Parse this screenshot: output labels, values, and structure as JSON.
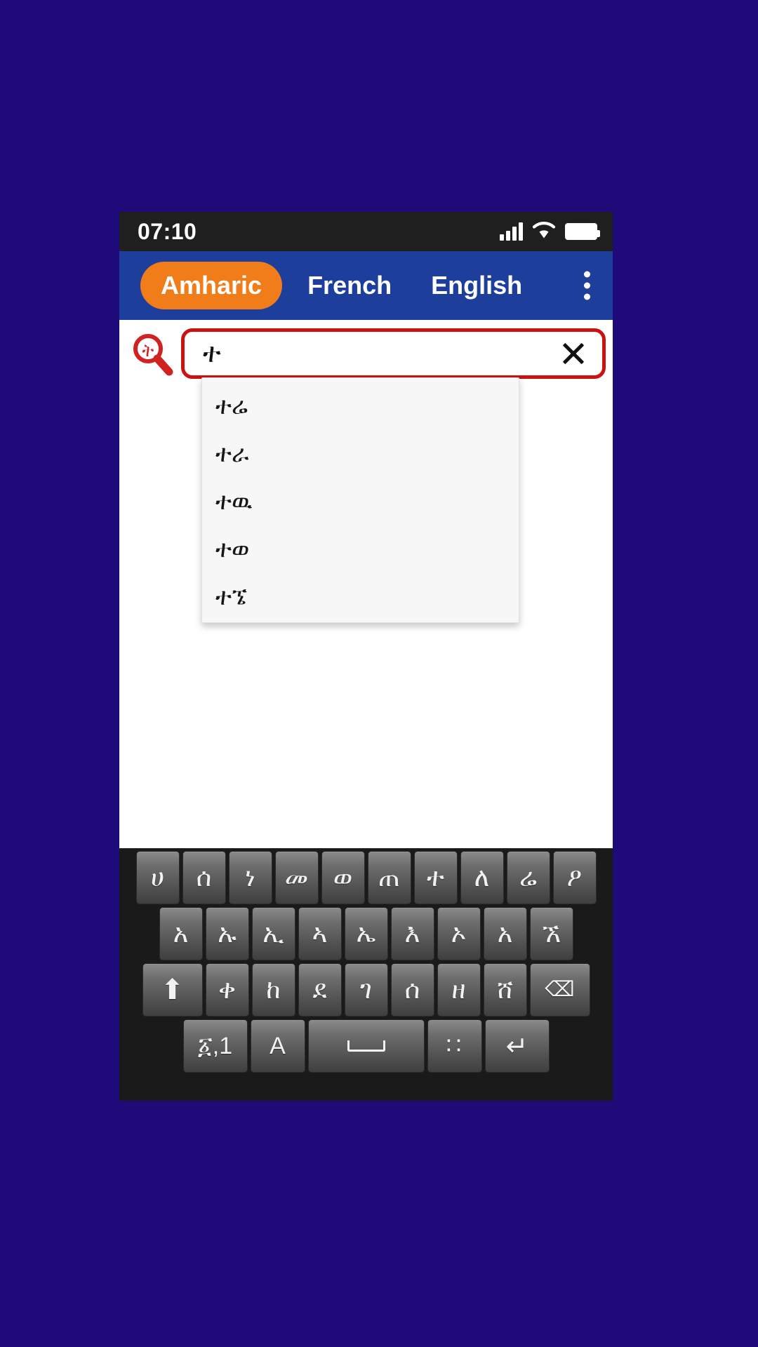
{
  "statusbar": {
    "time": "07:10",
    "icons": [
      "signal-bars-icon",
      "wifi-icon",
      "battery-icon"
    ]
  },
  "tabbar": {
    "tabs": [
      {
        "label": "Amharic",
        "active": true
      },
      {
        "label": "French",
        "active": false
      },
      {
        "label": "English",
        "active": false
      }
    ],
    "overflow_icon": "three-dot-menu-icon",
    "active_tab_color": "#f07d19",
    "bar_color": "#1e3e9c"
  },
  "search": {
    "icon": "search-magnifier-icon",
    "icon_letter": "ት",
    "value": "ተ",
    "placeholder": "",
    "clear_icon": "close-x-icon",
    "border_color": "#cc1111"
  },
  "suggestions": {
    "items": [
      {
        "label": "ተሬ"
      },
      {
        "label": "ተራ"
      },
      {
        "label": "ተዉ"
      },
      {
        "label": "ተወ"
      },
      {
        "label": "ተኜ"
      }
    ]
  },
  "keyboard": {
    "rows": [
      {
        "name": "row-1",
        "keys": [
          {
            "label": "ሀ",
            "name": "key-ha"
          },
          {
            "label": "ሰ",
            "name": "key-sa"
          },
          {
            "label": "ነ",
            "name": "key-na"
          },
          {
            "label": "መ",
            "name": "key-ma"
          },
          {
            "label": "ወ",
            "name": "key-wa"
          },
          {
            "label": "ጠ",
            "name": "key-ta-emphatic"
          },
          {
            "label": "ተ",
            "name": "key-ta"
          },
          {
            "label": "ለ",
            "name": "key-la"
          },
          {
            "label": "ሬ",
            "name": "key-re"
          },
          {
            "label": "ዖ",
            "name": "key-o"
          }
        ]
      },
      {
        "name": "row-2",
        "keys": [
          {
            "label": "አ",
            "name": "key-a"
          },
          {
            "label": "ኡ",
            "name": "key-u"
          },
          {
            "label": "ኢ",
            "name": "key-i"
          },
          {
            "label": "ኣ",
            "name": "key-aa"
          },
          {
            "label": "ኤ",
            "name": "key-e"
          },
          {
            "label": "እ",
            "name": "key-ie"
          },
          {
            "label": "ኦ",
            "name": "key-o-vowel"
          },
          {
            "label": "አ",
            "name": "key-a-alt"
          },
          {
            "label": "ኧ",
            "name": "key-wa-vowel"
          }
        ]
      },
      {
        "name": "row-3",
        "keys": [
          {
            "label": "⬆",
            "name": "shift-key",
            "glyph": "shift",
            "wide": true
          },
          {
            "label": "ቀ",
            "name": "key-qa"
          },
          {
            "label": "ከ",
            "name": "key-ka"
          },
          {
            "label": "ደ",
            "name": "key-da"
          },
          {
            "label": "ገ",
            "name": "key-ga"
          },
          {
            "label": "ሰ",
            "name": "key-sa-2"
          },
          {
            "label": "ዘ",
            "name": "key-za"
          },
          {
            "label": "ሸ",
            "name": "key-sha"
          },
          {
            "label": "⌫",
            "name": "backspace-key",
            "glyph": "backspace",
            "wide": true
          }
        ]
      },
      {
        "name": "row-4",
        "keys": [
          {
            "label": "፩,1",
            "name": "numbers-key",
            "cls": "fn"
          },
          {
            "label": "A",
            "name": "latin-key",
            "cls": "alpha"
          },
          {
            "label": "",
            "name": "space-key",
            "glyph": "space",
            "cls": "space"
          },
          {
            "label": "∷",
            "name": "punctuation-key",
            "glyph": "punc",
            "cls": "punc"
          },
          {
            "label": "↵",
            "name": "enter-key",
            "glyph": "enter",
            "cls": "ent"
          }
        ]
      }
    ]
  },
  "theme": {
    "page_background": "#1e0a78",
    "statusbar_background": "#1f1f1f",
    "keyboard_background": "#1a1a1a",
    "suggestion_background": "#f7f7f7"
  }
}
